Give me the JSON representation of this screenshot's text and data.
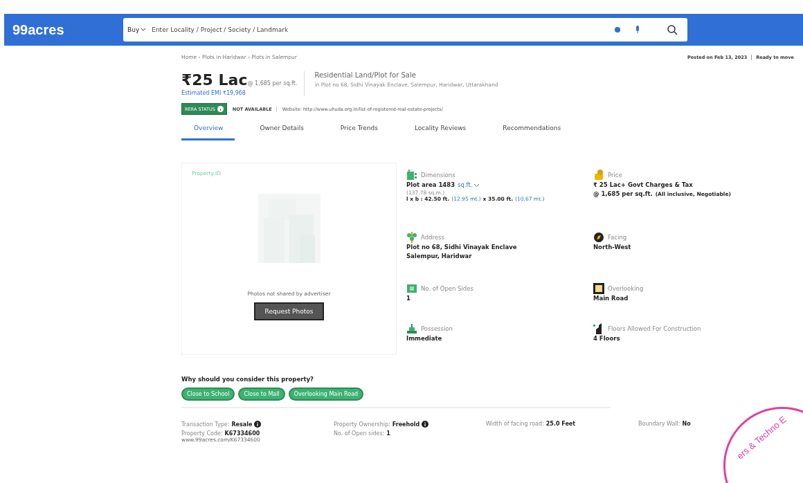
{
  "header": {
    "logo": "99acres",
    "search": {
      "buy_label": "Buy",
      "placeholder": "Enter Locality / Project / Society / Landmark"
    }
  },
  "breadcrumb": "Home › Plots in Haridwar › Plots in Salempur",
  "posted": "Posted on Feb 13, 2023",
  "availability": "Ready to move",
  "price": {
    "amount": "₹25 Lac",
    "rate": "@ 1,685 per sq.ft.",
    "emi": "Estimated EMI ₹19,968"
  },
  "listing": {
    "title": "Residential Land/Plot for Sale",
    "address": "in Plot no 68, Sidhi Vinayak Enclave, Salempur, Haridwar, Uttarakhand"
  },
  "rera": {
    "badge": "RERA STATUS",
    "status": "NOT AVAILABLE",
    "website": "Website: http://www.uhuda.org.in/list-of-registered-real-estate-projects/"
  },
  "tabs": [
    {
      "label": "Overview",
      "selected": true
    },
    {
      "label": "Owner Details",
      "selected": false
    },
    {
      "label": "Price Trends",
      "selected": false
    },
    {
      "label": "Locality Reviews",
      "selected": false
    },
    {
      "label": "Recommendations",
      "selected": false
    }
  ],
  "photo": {
    "kind": "picture",
    "property_id": "Property ID",
    "note": "Photos not shared by advertiser",
    "button": "Request Photos"
  },
  "details": [
    {
      "kind": "dimensions",
      "label": "Dimensions",
      "value": "Plot area 1483",
      "unit": "sq.ft.",
      "sub": "(137.78 sq.m.)",
      "lxb": [
        "l x b : 42.50 ft.",
        "(12.95 mt.)",
        "x 35.00 ft.",
        "(10.67 mt.)"
      ]
    },
    {
      "kind": "price",
      "label": "Price",
      "lines": [
        "₹ 25 Lac+ Govt Charges & Tax",
        "@ 1,685 per sq.ft."
      ],
      "note": "(All inclusive, Negotiable)"
    },
    {
      "kind": "text",
      "label": "Address",
      "lines": [
        "Plot no 68, Sidhi Vinayak Enclave",
        "Salempur, Haridwar"
      ]
    },
    {
      "kind": "text",
      "label": "Facing",
      "lines": [
        "North-West"
      ]
    },
    {
      "kind": "text",
      "label": "No. of Open Sides",
      "lines": [
        "1"
      ]
    },
    {
      "kind": "text",
      "label": "Overlooking",
      "lines": [
        "Main Road"
      ]
    },
    {
      "kind": "text",
      "label": "Possession",
      "lines": [
        "Immediate"
      ]
    },
    {
      "kind": "text",
      "label": "Floors Allowed For Construction",
      "lines": [
        "4 Floors"
      ]
    }
  ],
  "reasons": {
    "title": "Why should you consider this property?",
    "chips": [
      "Close to School",
      "Close to Mall",
      "Overlooking Main Road"
    ]
  },
  "facts": [
    {
      "label": "Transaction Type:",
      "value": "Resale",
      "info": true
    },
    {
      "label": "Property Ownership:",
      "value": "Freehold",
      "info": true
    },
    {
      "label": "Width of facing road:",
      "value": "25.0 Feet",
      "info": false
    },
    {
      "label": "Boundary Wall:",
      "value": "No",
      "info": false
    },
    {
      "label": "Property Code:",
      "value": "K67334600",
      "info": false,
      "sub": "www.99acres.com/K67334600"
    },
    {
      "label": "No. of Open sides:",
      "value": "1",
      "info": false
    }
  ],
  "stamp": {
    "text": "ers & Techno E"
  }
}
